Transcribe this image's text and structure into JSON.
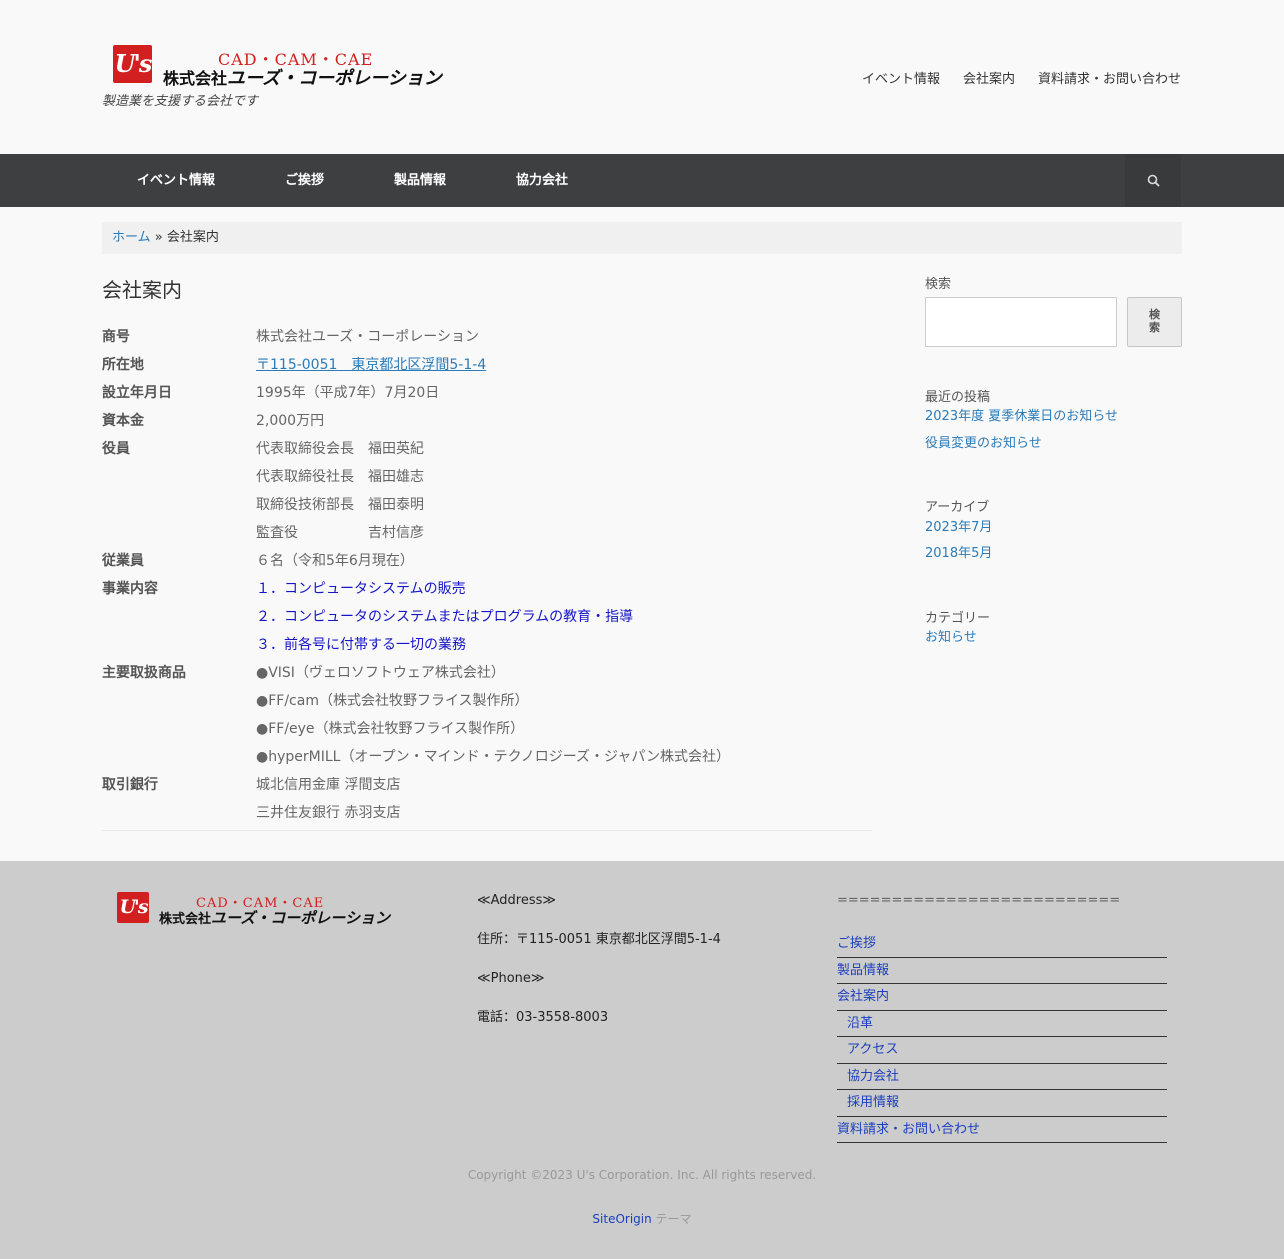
{
  "header": {
    "logo": {
      "mark": "U's",
      "products": "CAD・CAM・CAE",
      "company_prefix": "株式会社",
      "company_name": "ユーズ・コーポレーション"
    },
    "tagline": "製造業を支援する会社です",
    "top_nav": [
      "イベント情報",
      "会社案内",
      "資料請求・お問い合わせ"
    ]
  },
  "main_nav": {
    "items": [
      "イベント情報",
      "ご挨拶",
      "製品情報",
      "協力会社"
    ],
    "search_icon": "search-icon"
  },
  "breadcrumb": {
    "home": "ホーム",
    "separator": " » ",
    "current": "会社案内"
  },
  "page": {
    "title": "会社案内",
    "rows": [
      {
        "label": "商号",
        "values": [
          "株式会社ユーズ・コーポレーション"
        ]
      },
      {
        "label": "所在地",
        "values": [
          "〒115-0051　東京都北区浮間5-1-4"
        ]
      },
      {
        "label": "設立年月日",
        "values": [
          "1995年（平成7年）7月20日"
        ]
      },
      {
        "label": "資本金",
        "values": [
          "2,000万円"
        ]
      },
      {
        "label": "役員",
        "values": [
          "代表取締役会長　福田英紀",
          "代表取締役社長　福田雄志",
          "取締役技術部長　福田泰明",
          "監査役　　　　　吉村信彦"
        ]
      },
      {
        "label": "従業員",
        "values": [
          "６名（令和5年6月現在）"
        ]
      },
      {
        "label": "事業内容",
        "values": [
          "１．コンピュータシステムの販売",
          "２．コンピュータのシステムまたはプログラムの教育・指導",
          "３．前各号に付帯する一切の業務"
        ]
      },
      {
        "label": "主要取扱商品",
        "values": [
          "●VISI（ヴェロソフトウェア株式会社）",
          "●FF/cam（株式会社牧野フライス製作所）",
          "●FF/eye（株式会社牧野フライス製作所）",
          "●hyperMILL（オープン・マインド・テクノロジーズ・ジャパン株式会社）"
        ]
      },
      {
        "label": "取引銀行",
        "values": [
          "城北信用金庫 浮間支店",
          "三井住友銀行 赤羽支店"
        ]
      }
    ]
  },
  "sidebar": {
    "search_title": "検索",
    "search_value": "",
    "search_button": "検索",
    "recent_title": "最近の投稿",
    "recent_posts": [
      "2023年度 夏季休業日のお知らせ",
      "役員変更のお知らせ"
    ],
    "archive_title": "アーカイブ",
    "archives": [
      "2023年7月",
      "2018年5月"
    ],
    "category_title": "カテゴリー",
    "categories": [
      "お知らせ"
    ]
  },
  "footer": {
    "address_heading": "≪Address≫",
    "address": "住所：〒115-0051 東京都北区浮間5-1-4",
    "phone_heading": "≪Phone≫",
    "phone": "電話：03-3558-8003",
    "separator": "==========================",
    "menu": [
      "ご挨拶",
      "製品情報",
      "会社案内",
      "沿革",
      "アクセス",
      "協力会社",
      "採用情報",
      "資料請求・お問い合わせ"
    ],
    "copyright": "Copyright ©2023 U's Corporation. Inc. All rights reserved.",
    "theme_link": "SiteOrigin",
    "theme_suffix": " テーマ"
  }
}
